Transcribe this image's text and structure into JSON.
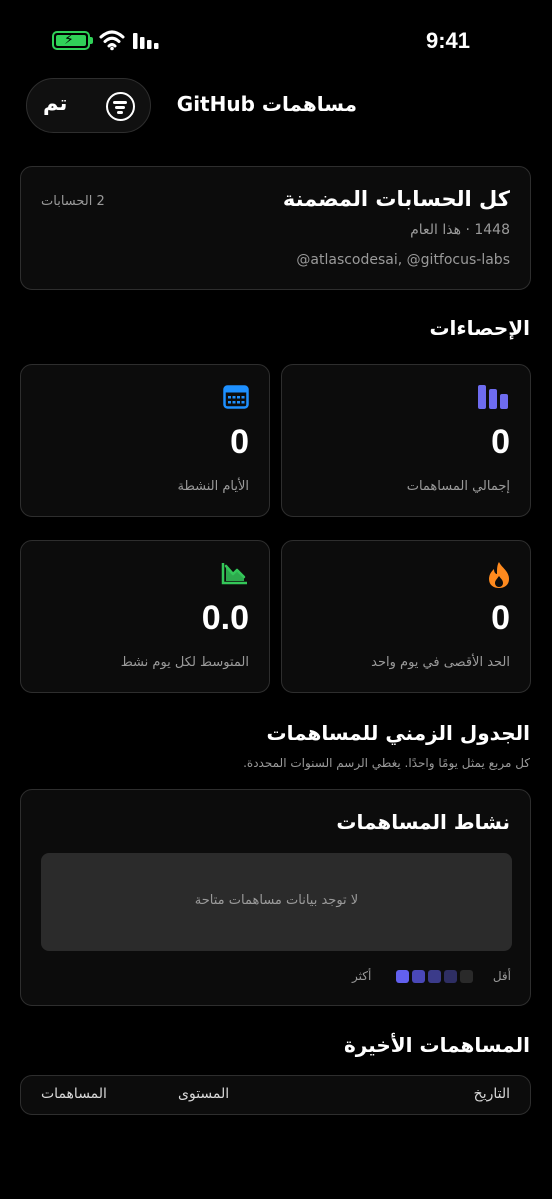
{
  "status_bar": {
    "time": "9:41",
    "icons": [
      "battery-charging-icon",
      "wifi-icon",
      "signal-icon"
    ]
  },
  "header": {
    "done_label": "تم",
    "filter_icon": "filter-icon",
    "title": "مساهمات GitHub"
  },
  "accounts": {
    "title": "كل الحسابات المضمنة",
    "count": "2 الحسابات",
    "year_line": "1448 · هذا العام",
    "usernames": "@atlascodesai, @gitfocus-labs"
  },
  "stats": {
    "section_title": "الإحصاءات",
    "cards": [
      {
        "label": "إجمالي المساهمات",
        "value": "0",
        "icon": "bar-chart-icon",
        "color": "#6e6cf0"
      },
      {
        "label": "الأيام النشطة",
        "value": "0",
        "icon": "calendar-icon",
        "color": "#1e90ff"
      },
      {
        "label": "الحد الأقصى في يوم واحد",
        "value": "0",
        "icon": "flame-icon",
        "color": "#ff8a1e"
      },
      {
        "label": "المتوسط لكل يوم نشط",
        "value": "0.0",
        "icon": "trend-chart-icon",
        "color": "#34c759"
      }
    ]
  },
  "timeline": {
    "title": "الجدول الزمني للمساهمات",
    "subtitle": "كل مربع يمثل يومًا واحدًا. يغطي الرسم السنوات المحددة.",
    "card_title": "نشاط المساهمات",
    "empty_text": "لا توجد بيانات مساهمات متاحة",
    "legend_less": "أقل",
    "legend_more": "أكثر",
    "legend_colors": [
      "#2a2a2a",
      "#2e2e63",
      "#3b3b8a",
      "#4a48b8",
      "#6260ee"
    ]
  },
  "recent": {
    "title": "المساهمات الأخيرة",
    "columns": [
      "التاريخ",
      "المستوى",
      "المساهمات"
    ]
  }
}
